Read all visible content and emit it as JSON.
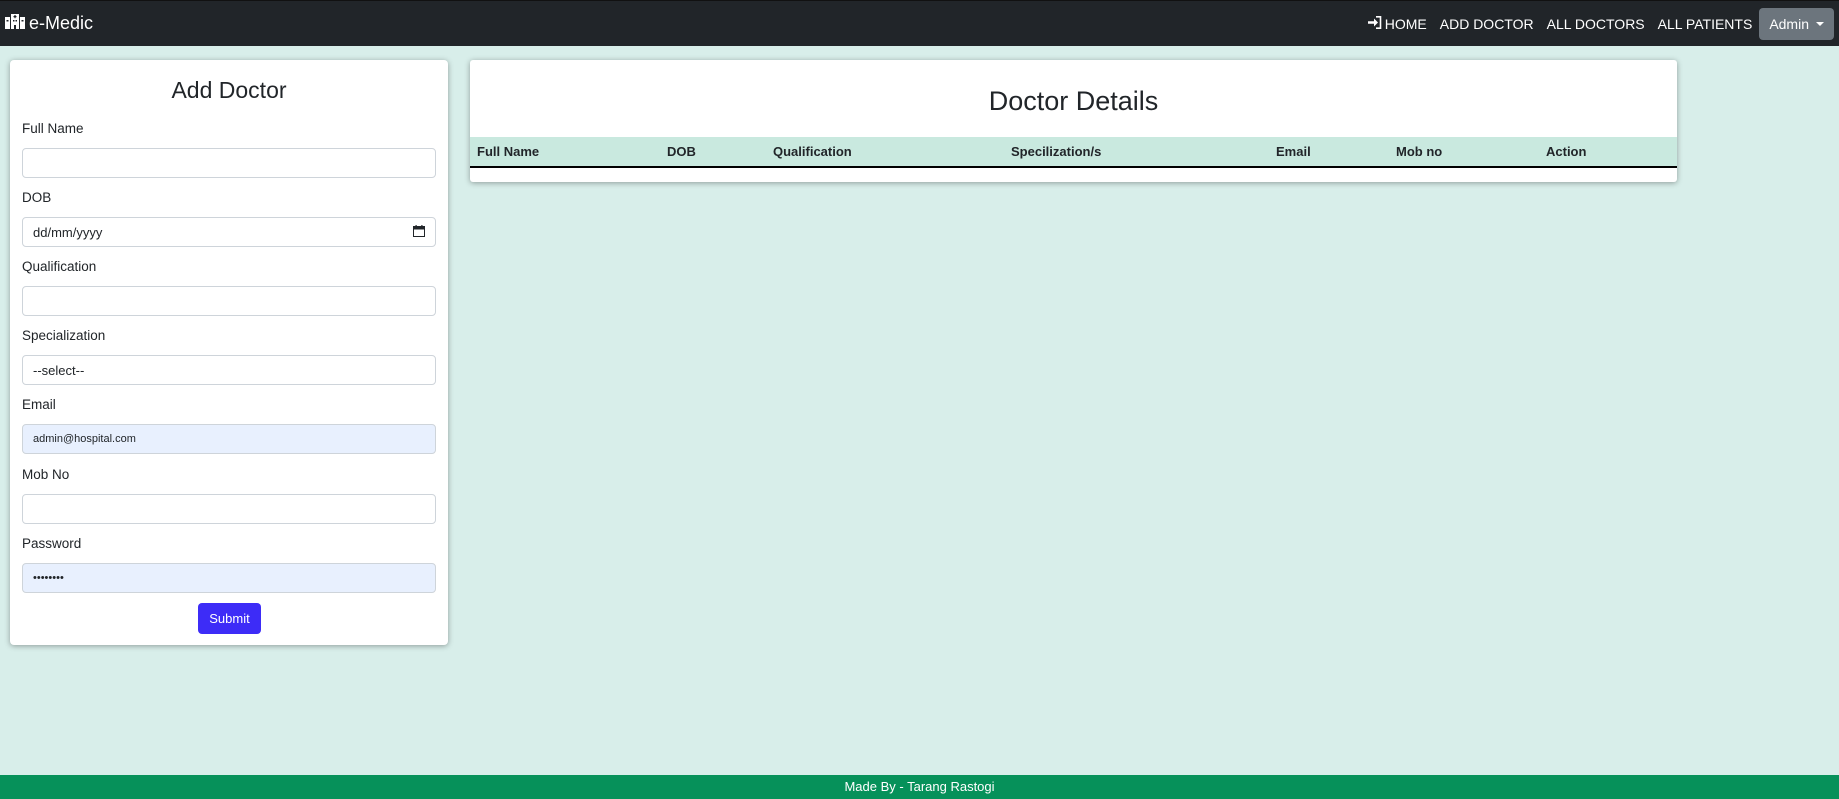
{
  "navbar": {
    "brand": "e-Medic",
    "links": [
      {
        "label": "HOME",
        "icon": "sign-in-icon"
      },
      {
        "label": "ADD DOCTOR"
      },
      {
        "label": "ALL DOCTORS"
      },
      {
        "label": "ALL PATIENTS"
      }
    ],
    "user_menu": "Admin"
  },
  "form": {
    "title": "Add Doctor",
    "fields": {
      "full_name": {
        "label": "Full Name",
        "value": ""
      },
      "dob": {
        "label": "DOB",
        "value": "dd/mm/yyyy"
      },
      "qualification": {
        "label": "Qualification",
        "value": ""
      },
      "specialization": {
        "label": "Specialization",
        "value": "--select--"
      },
      "email": {
        "label": "Email",
        "value": "admin@hospital.com"
      },
      "mob_no": {
        "label": "Mob No",
        "value": ""
      },
      "password": {
        "label": "Password",
        "value": "••••••••"
      }
    },
    "submit_label": "Submit"
  },
  "table": {
    "title": "Doctor Details",
    "columns": [
      "Full Name",
      "DOB",
      "Qualification",
      "Specilization/s",
      "Email",
      "Mob no",
      "Action"
    ],
    "rows": []
  },
  "footer": {
    "text": "Made By - Tarang Rastogi"
  },
  "colors": {
    "navbar": "#212529",
    "background": "#d8eeea",
    "table_header": "#c9e9df",
    "submit_button": "#3d2cf7",
    "footer": "#06915a"
  }
}
